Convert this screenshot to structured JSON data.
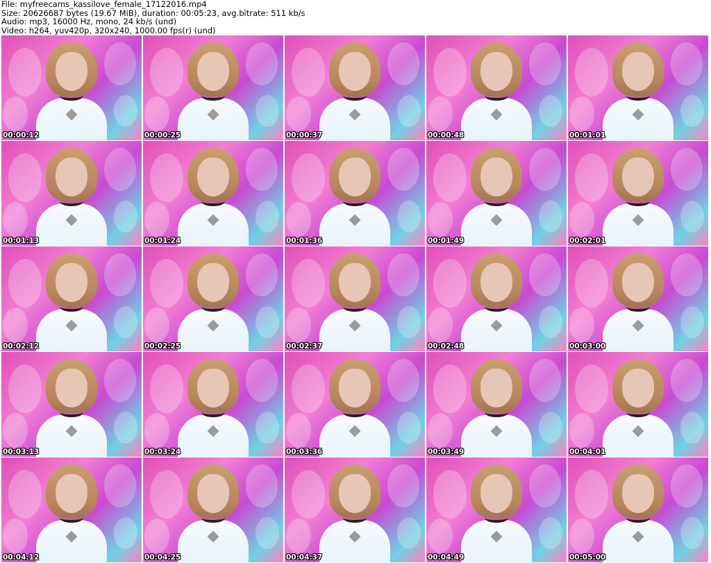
{
  "header": {
    "file_line": "File: myfreecams_kassilove_female_17122016.mp4",
    "size_line": "Size: 20626687 bytes (19.67 MiB), duration: 00:05:23, avg.bitrate: 511 kb/s",
    "audio_line": "Audio: mp3, 16000 Hz, mono, 24 kb/s (und)",
    "video_line": "Video: h264, yuv420p, 320x240, 1000.00 fps(r) (und)"
  },
  "thumbnails": [
    {
      "timestamp": "00:00:12"
    },
    {
      "timestamp": "00:00:25"
    },
    {
      "timestamp": "00:00:37"
    },
    {
      "timestamp": "00:00:48"
    },
    {
      "timestamp": "00:01:01"
    },
    {
      "timestamp": "00:01:13"
    },
    {
      "timestamp": "00:01:24"
    },
    {
      "timestamp": "00:01:36"
    },
    {
      "timestamp": "00:01:49"
    },
    {
      "timestamp": "00:02:01"
    },
    {
      "timestamp": "00:02:12"
    },
    {
      "timestamp": "00:02:25"
    },
    {
      "timestamp": "00:02:37"
    },
    {
      "timestamp": "00:02:48"
    },
    {
      "timestamp": "00:03:00"
    },
    {
      "timestamp": "00:03:13"
    },
    {
      "timestamp": "00:03:24"
    },
    {
      "timestamp": "00:03:36"
    },
    {
      "timestamp": "00:03:49"
    },
    {
      "timestamp": "00:04:01"
    },
    {
      "timestamp": "00:04:12"
    },
    {
      "timestamp": "00:04:25"
    },
    {
      "timestamp": "00:04:37"
    },
    {
      "timestamp": "00:04:49"
    },
    {
      "timestamp": "00:05:00"
    }
  ]
}
